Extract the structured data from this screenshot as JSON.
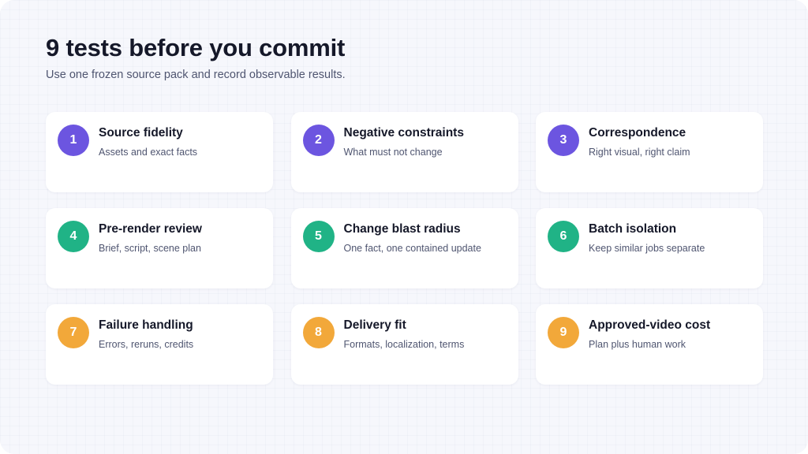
{
  "header": {
    "title": "9 tests before you commit",
    "subtitle": "Use one frozen source pack and record observable results."
  },
  "colors": {
    "background": "#f6f7fc",
    "card": "#ffffff",
    "purple": "#6c55e0",
    "green": "#20b386",
    "orange": "#f2a83a"
  },
  "cards": [
    {
      "number": "1",
      "title": "Source fidelity",
      "desc": "Assets and exact facts",
      "color": "#6c55e0"
    },
    {
      "number": "2",
      "title": "Negative constraints",
      "desc": "What must not change",
      "color": "#6c55e0"
    },
    {
      "number": "3",
      "title": "Correspondence",
      "desc": "Right visual, right claim",
      "color": "#6c55e0"
    },
    {
      "number": "4",
      "title": "Pre-render review",
      "desc": "Brief, script, scene plan",
      "color": "#20b386"
    },
    {
      "number": "5",
      "title": "Change blast radius",
      "desc": "One fact, one contained update",
      "color": "#20b386"
    },
    {
      "number": "6",
      "title": "Batch isolation",
      "desc": "Keep similar jobs separate",
      "color": "#20b386"
    },
    {
      "number": "7",
      "title": "Failure handling",
      "desc": "Errors, reruns, credits",
      "color": "#f2a83a"
    },
    {
      "number": "8",
      "title": "Delivery fit",
      "desc": "Formats, localization, terms",
      "color": "#f2a83a"
    },
    {
      "number": "9",
      "title": "Approved-video cost",
      "desc": "Plan plus human work",
      "color": "#f2a83a"
    }
  ]
}
